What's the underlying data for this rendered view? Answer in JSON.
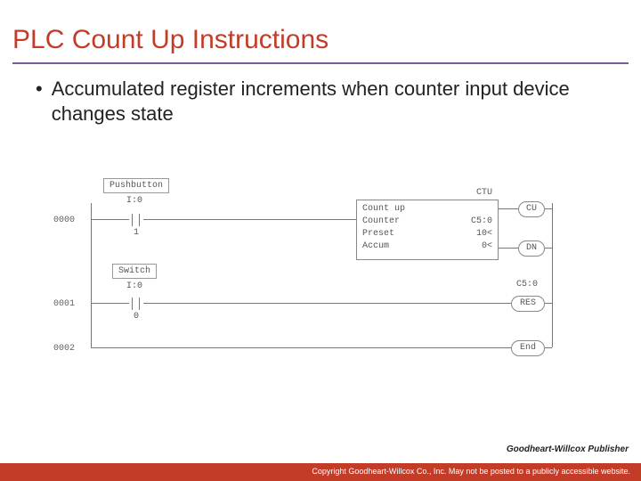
{
  "title": "PLC Count Up Instructions",
  "bullet": "Accumulated register increments when counter input device changes state",
  "diagram": {
    "rungs": [
      "0000",
      "0001",
      "0002"
    ],
    "input1": {
      "tag": "Pushbutton",
      "addr": "I:0",
      "bit": "1"
    },
    "input2": {
      "tag": "Switch",
      "addr": "I:0",
      "bit": "0"
    },
    "ctu_block": {
      "header": "CTU",
      "r1": "Count up",
      "r2l": "Counter",
      "r2r": "C5:0",
      "r3l": "Preset",
      "r3r": "10<",
      "r4l": "Accum",
      "r4r": "0<"
    },
    "cu_pill": "CU",
    "dn_pill": "DN",
    "res_pill": "RES",
    "res_addr": "C5:0",
    "end_pill": "End"
  },
  "publisher": "Goodheart-Willcox Publisher",
  "footer": "Copyright Goodheart-Willcox Co., Inc.  May not be posted to a publicly accessible website."
}
